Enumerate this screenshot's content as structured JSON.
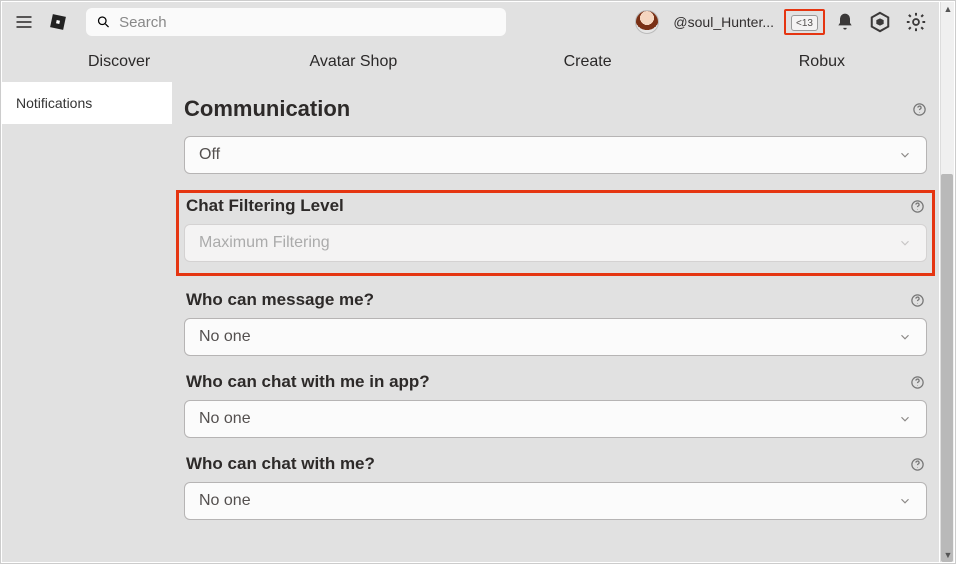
{
  "header": {
    "search_placeholder": "Search",
    "username": "@soul_Hunter...",
    "age_badge": "<13"
  },
  "nav": {
    "items": [
      "Discover",
      "Avatar Shop",
      "Create",
      "Robux"
    ]
  },
  "sidebar": {
    "tab_label": "Notifications"
  },
  "main": {
    "section_title": "Communication",
    "field_top": {
      "value": "Off"
    },
    "highlight": {
      "label": "Chat Filtering Level",
      "value": "Maximum Filtering"
    },
    "fields": [
      {
        "label": "Who can message me?",
        "value": "No one"
      },
      {
        "label": "Who can chat with me in app?",
        "value": "No one"
      },
      {
        "label": "Who can chat with me?",
        "value": "No one"
      }
    ]
  }
}
